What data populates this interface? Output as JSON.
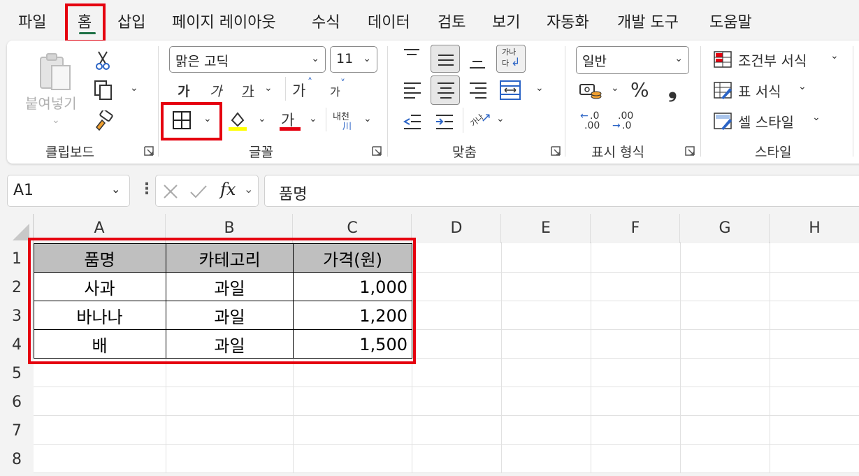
{
  "menu": {
    "tabs": [
      "파일",
      "홈",
      "삽입",
      "페이지 레이아웃",
      "수식",
      "데이터",
      "검토",
      "보기",
      "자동화",
      "개발 도구",
      "도움말"
    ],
    "active": "홈"
  },
  "ribbon": {
    "clipboard": {
      "paste_label": "붙여넣기",
      "group_label": "클립보드"
    },
    "font": {
      "font_name": "맑은 고딕",
      "font_size": "11",
      "bold": "가",
      "italic": "가",
      "underline": "가",
      "grow": "가",
      "shrink": "가",
      "phonetic": "내천",
      "font_color_glyph": "가",
      "group_label": "글꼴"
    },
    "alignment": {
      "wrap_glyph_top": "가나",
      "wrap_glyph_bottom": "다",
      "orientation_glyph": "가나",
      "group_label": "맞춤"
    },
    "number": {
      "format": "일반",
      "percent": "%",
      "comma": "❟",
      "inc_decimal_top": ".0",
      "inc_decimal_bottom": ".00",
      "dec_decimal_top": ".00",
      "dec_decimal_bottom": ".0",
      "group_label": "표시 형식"
    },
    "styles": {
      "conditional": "조건부 서식",
      "table_format": "표 서식",
      "cell_style": "셀 스타일",
      "group_label": "스타일"
    }
  },
  "formula_bar": {
    "name_box": "A1",
    "fx": "fx",
    "content": "품명"
  },
  "grid": {
    "columns": [
      "A",
      "B",
      "C",
      "D",
      "E",
      "F",
      "G",
      "H"
    ],
    "rows": [
      "1",
      "2",
      "3",
      "4",
      "5",
      "6",
      "7",
      "8"
    ],
    "header_row": [
      "품명",
      "카테고리",
      "가격(원)"
    ],
    "data": [
      [
        "사과",
        "과일",
        "1,000"
      ],
      [
        "바나나",
        "과일",
        "1,200"
      ],
      [
        "배",
        "과일",
        "1,500"
      ]
    ]
  },
  "colors": {
    "accent": "#1e7145",
    "highlight_box": "#e5000f",
    "header_fill": "#bfbfbf",
    "fill_color_bar": "#ffff00",
    "font_color_bar": "#e5000f"
  }
}
